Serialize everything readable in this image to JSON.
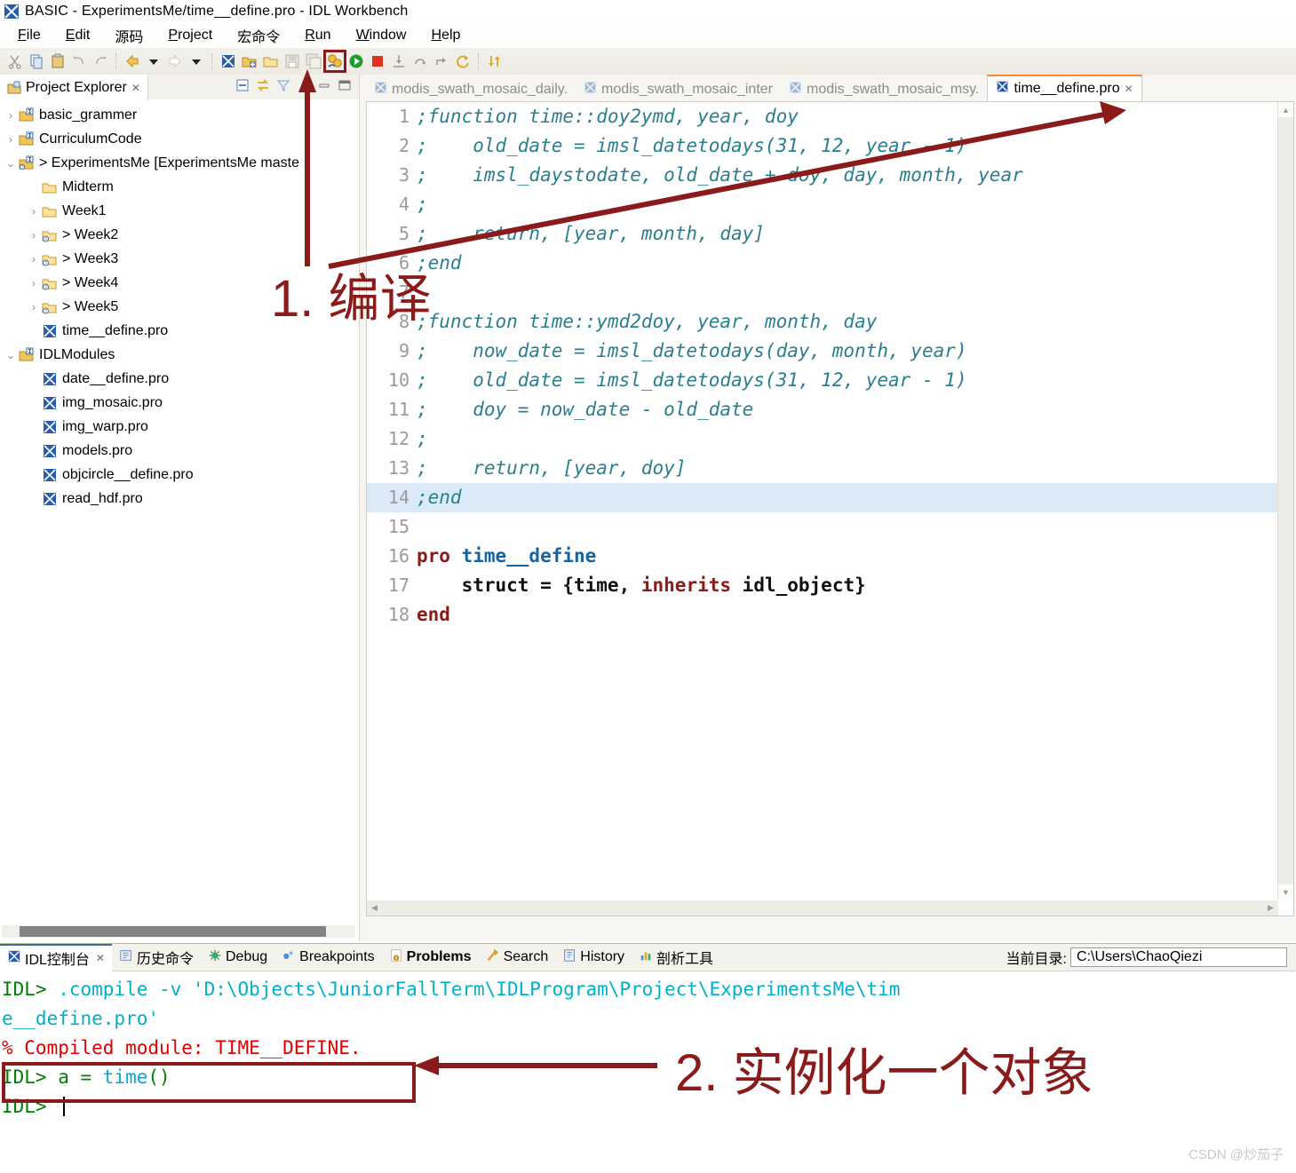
{
  "window": {
    "title": "BASIC - ExperimentsMe/time__define.pro - IDL Workbench",
    "app_icon": "idl-app-icon"
  },
  "menubar": {
    "items": [
      {
        "label": "File",
        "mnemonic": "F"
      },
      {
        "label": "Edit",
        "mnemonic": "E"
      },
      {
        "label": "源码",
        "mnemonic": ""
      },
      {
        "label": "Project",
        "mnemonic": "P"
      },
      {
        "label": "宏命令",
        "mnemonic": ""
      },
      {
        "label": "Run",
        "mnemonic": "R"
      },
      {
        "label": "Window",
        "mnemonic": "W"
      },
      {
        "label": "Help",
        "mnemonic": "H"
      }
    ]
  },
  "toolbar": {
    "buttons": [
      {
        "name": "cut-icon",
        "glyph": "✂",
        "color": "#9a9a90",
        "highlight": false
      },
      {
        "name": "copy-icon",
        "glyph": "❐",
        "color": "#5a7fb5",
        "highlight": false
      },
      {
        "name": "paste-icon",
        "glyph": "📋",
        "color": "#c8a24a",
        "highlight": false
      },
      {
        "name": "undo-icon",
        "glyph": "↩",
        "color": "#b9b6ab",
        "highlight": false
      },
      {
        "name": "redo-icon",
        "glyph": "↪",
        "color": "#b9b6ab",
        "highlight": false
      },
      {
        "name": "back-arrow-icon",
        "glyph": "⬅",
        "color": "#e0a828",
        "highlight": false
      },
      {
        "name": "back-dropdown-icon",
        "glyph": "▼",
        "color": "#333333",
        "highlight": false
      },
      {
        "name": "forward-arrow-icon",
        "glyph": "➡",
        "color": "#cfcabc",
        "highlight": false
      },
      {
        "name": "forward-dropdown-icon",
        "glyph": "▼",
        "color": "#333333",
        "highlight": false
      },
      {
        "name": "new-idl-file-icon",
        "glyph": "▨",
        "color": "#2a5caa",
        "highlight": false
      },
      {
        "name": "new-project-icon",
        "glyph": "🗀",
        "color": "#d8a43c",
        "highlight": false
      },
      {
        "name": "open-folder-icon",
        "glyph": "🗁",
        "color": "#d8a43c",
        "highlight": false
      },
      {
        "name": "save-icon",
        "glyph": "💾",
        "color": "#b9b6ab",
        "highlight": false
      },
      {
        "name": "save-all-icon",
        "glyph": "🖫",
        "color": "#b9b6ab",
        "highlight": false
      },
      {
        "name": "compile-icon",
        "glyph": "⚙",
        "color": "#e0a828",
        "highlight": true
      },
      {
        "name": "run-icon",
        "glyph": "▶",
        "color": "#1f9d2f",
        "highlight": false
      },
      {
        "name": "stop-icon",
        "glyph": "■",
        "color": "#e03020",
        "highlight": false
      },
      {
        "name": "step-into-icon",
        "glyph": "⤓",
        "color": "#9a9a90",
        "highlight": false
      },
      {
        "name": "step-over-icon",
        "glyph": "⤵",
        "color": "#9a9a90",
        "highlight": false
      },
      {
        "name": "step-return-icon",
        "glyph": "⤴",
        "color": "#9a9a90",
        "highlight": false
      },
      {
        "name": "reset-icon",
        "glyph": "⟳",
        "color": "#e0a828",
        "highlight": false
      },
      {
        "name": "profile-icon",
        "glyph": "⇅",
        "color": "#e0a828",
        "highlight": false
      }
    ]
  },
  "explorer": {
    "tab_label": "Project Explorer",
    "tab_close": "✕",
    "tools": [
      {
        "name": "collapse-all-icon",
        "glyph": "⊟"
      },
      {
        "name": "link-with-editor-icon",
        "glyph": "⇆"
      },
      {
        "name": "view-filter-icon",
        "glyph": "▽"
      },
      {
        "name": "view-menu-icon",
        "glyph": "⋮"
      },
      {
        "name": "minimize-view-icon",
        "glyph": "▭"
      },
      {
        "name": "maximize-view-icon",
        "glyph": "❐"
      }
    ],
    "tree": [
      {
        "label": "basic_grammer",
        "indent": 0,
        "twist": "›",
        "icon": "project-icon"
      },
      {
        "label": "CurriculumCode",
        "indent": 0,
        "twist": "›",
        "icon": "project-icon"
      },
      {
        "label": "> ExperimentsMe [ExperimentsMe maste",
        "indent": 0,
        "twist": "⌄",
        "icon": "project-git-icon"
      },
      {
        "label": "Midterm",
        "indent": 1,
        "twist": "",
        "icon": "folder-icon"
      },
      {
        "label": "Week1",
        "indent": 1,
        "twist": "›",
        "icon": "folder-icon"
      },
      {
        "label": "> Week2",
        "indent": 1,
        "twist": "›",
        "icon": "folder-git-icon"
      },
      {
        "label": "> Week3",
        "indent": 1,
        "twist": "›",
        "icon": "folder-git-icon"
      },
      {
        "label": "> Week4",
        "indent": 1,
        "twist": "›",
        "icon": "folder-git-icon"
      },
      {
        "label": "> Week5",
        "indent": 1,
        "twist": "›",
        "icon": "folder-git-icon"
      },
      {
        "label": "time__define.pro",
        "indent": 1,
        "twist": "",
        "icon": "pro-file-icon"
      },
      {
        "label": "IDLModules",
        "indent": 0,
        "twist": "⌄",
        "icon": "project-icon"
      },
      {
        "label": "date__define.pro",
        "indent": 1,
        "twist": "",
        "icon": "pro-file-icon"
      },
      {
        "label": "img_mosaic.pro",
        "indent": 1,
        "twist": "",
        "icon": "pro-file-icon"
      },
      {
        "label": "img_warp.pro",
        "indent": 1,
        "twist": "",
        "icon": "pro-file-icon"
      },
      {
        "label": "models.pro",
        "indent": 1,
        "twist": "",
        "icon": "pro-file-icon"
      },
      {
        "label": "objcircle__define.pro",
        "indent": 1,
        "twist": "",
        "icon": "pro-file-icon"
      },
      {
        "label": "read_hdf.pro",
        "indent": 1,
        "twist": "",
        "icon": "pro-file-icon"
      }
    ]
  },
  "editor": {
    "tabs": [
      {
        "label": "modis_swath_mosaic_daily.",
        "active": false,
        "close": ""
      },
      {
        "label": "modis_swath_mosaic_inter",
        "active": false,
        "close": ""
      },
      {
        "label": "modis_swath_mosaic_msy.",
        "active": false,
        "close": ""
      },
      {
        "label": "time__define.pro",
        "active": true,
        "close": "✕"
      }
    ],
    "highlighted_line": 14,
    "lines": [
      {
        "n": "1",
        "type": "comment",
        "text": ";function time::doy2ymd, year, doy"
      },
      {
        "n": "2",
        "type": "comment",
        "text": ";    old_date = imsl_datetodays(31, 12, year - 1)"
      },
      {
        "n": "3",
        "type": "comment",
        "text": ";    imsl_daystodate, old_date + doy, day, month, year"
      },
      {
        "n": "4",
        "type": "comment",
        "text": ";"
      },
      {
        "n": "5",
        "type": "comment",
        "text": ";    return, [year, month, day]"
      },
      {
        "n": "6",
        "type": "comment",
        "text": ";end"
      },
      {
        "n": "7",
        "type": "blank",
        "text": ""
      },
      {
        "n": "8",
        "type": "comment",
        "text": ";function time::ymd2doy, year, month, day"
      },
      {
        "n": "9",
        "type": "comment",
        "text": ";    now_date = imsl_datetodays(day, month, year)"
      },
      {
        "n": "10",
        "type": "comment",
        "text": ";    old_date = imsl_datetodays(31, 12, year - 1)"
      },
      {
        "n": "11",
        "type": "comment",
        "text": ";    doy = now_date - old_date"
      },
      {
        "n": "12",
        "type": "comment",
        "text": ";"
      },
      {
        "n": "13",
        "type": "comment",
        "text": ";    return, [year, doy]"
      },
      {
        "n": "14",
        "type": "comment",
        "text": ";end"
      },
      {
        "n": "15",
        "type": "blank",
        "text": ""
      },
      {
        "n": "16",
        "type": "code",
        "text": "pro time__define",
        "kw": "pro",
        "fn": "time__define"
      },
      {
        "n": "17",
        "type": "code17",
        "text": "    struct = {time, inherits idl_object}"
      },
      {
        "n": "18",
        "type": "code",
        "text": "end",
        "kw": "end",
        "fn": ""
      }
    ]
  },
  "console": {
    "tabs": [
      {
        "label": "IDL控制台",
        "icon": "idl-console-icon",
        "active": true,
        "bold": false,
        "close": "✕"
      },
      {
        "label": "历史命令",
        "icon": "history-cmd-icon",
        "active": false,
        "bold": false,
        "close": ""
      },
      {
        "label": "Debug",
        "icon": "debug-icon",
        "active": false,
        "bold": false,
        "close": ""
      },
      {
        "label": "Breakpoints",
        "icon": "breakpoints-icon",
        "active": false,
        "bold": false,
        "close": ""
      },
      {
        "label": "Problems",
        "icon": "problems-icon",
        "active": false,
        "bold": true,
        "close": ""
      },
      {
        "label": "Search",
        "icon": "search-icon",
        "active": false,
        "bold": false,
        "close": ""
      },
      {
        "label": "History",
        "icon": "history-icon",
        "active": false,
        "bold": false,
        "close": ""
      },
      {
        "label": "剖析工具",
        "icon": "profiler-icon",
        "active": false,
        "bold": false,
        "close": ""
      }
    ],
    "curdir_label": "当前目录:",
    "curdir_value": "C:\\Users\\ChaoQiezi",
    "output": [
      {
        "segments": [
          {
            "text": "IDL> ",
            "color": "green"
          },
          {
            "text": ".compile -v 'D:\\Objects\\JuniorFallTerm\\IDLProgram\\Project\\ExperimentsMe\\tim",
            "color": "cyan"
          }
        ]
      },
      {
        "segments": [
          {
            "text": "e__define.pro'",
            "color": "cyan"
          }
        ]
      },
      {
        "segments": [
          {
            "text": "% Compiled module: TIME__DEFINE.",
            "color": "red"
          }
        ]
      },
      {
        "segments": [
          {
            "text": "IDL> ",
            "color": "green"
          },
          {
            "text": "a = ",
            "color": "green"
          },
          {
            "text": "time",
            "color": "blue"
          },
          {
            "text": "()",
            "color": "green"
          }
        ]
      },
      {
        "segments": [
          {
            "text": "IDL> ",
            "color": "green"
          }
        ]
      }
    ]
  },
  "annotations": {
    "step1": "1. 编译",
    "step2": "2. 实例化一个对象",
    "accent_color": "#8b1a1a"
  },
  "watermark": "CSDN @炒茄子"
}
